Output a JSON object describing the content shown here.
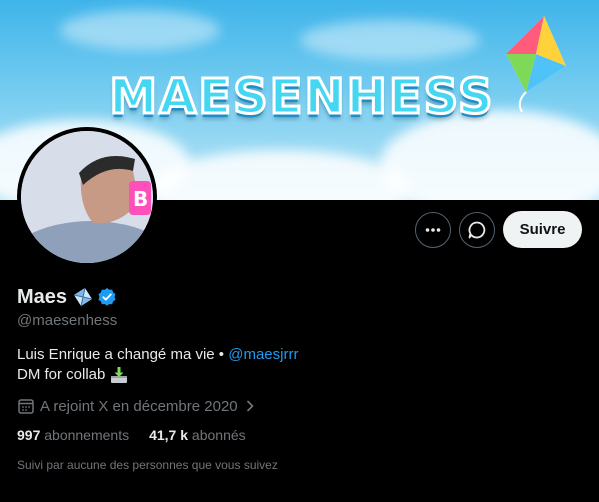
{
  "banner": {
    "title": "MAESENHESS"
  },
  "profile": {
    "display_name": "Maes",
    "handle": "@maesenhess",
    "bio_line1": "Luis Enrique a changé ma vie •",
    "bio_mention": "@maesjrrr",
    "bio_line2": "DM for collab",
    "joined": "A rejoint X en décembre 2020",
    "following_count": "997",
    "following_label": "abonnements",
    "followers_count": "41,7 k",
    "followers_label": "abonnés",
    "followed_by": "Suivi par aucune des personnes que vous suivez"
  },
  "actions": {
    "follow_label": "Suivre"
  },
  "colors": {
    "accent": "#1d9bf0",
    "verified": "#1d9bf0",
    "background": "#000000",
    "muted": "#71767b"
  }
}
